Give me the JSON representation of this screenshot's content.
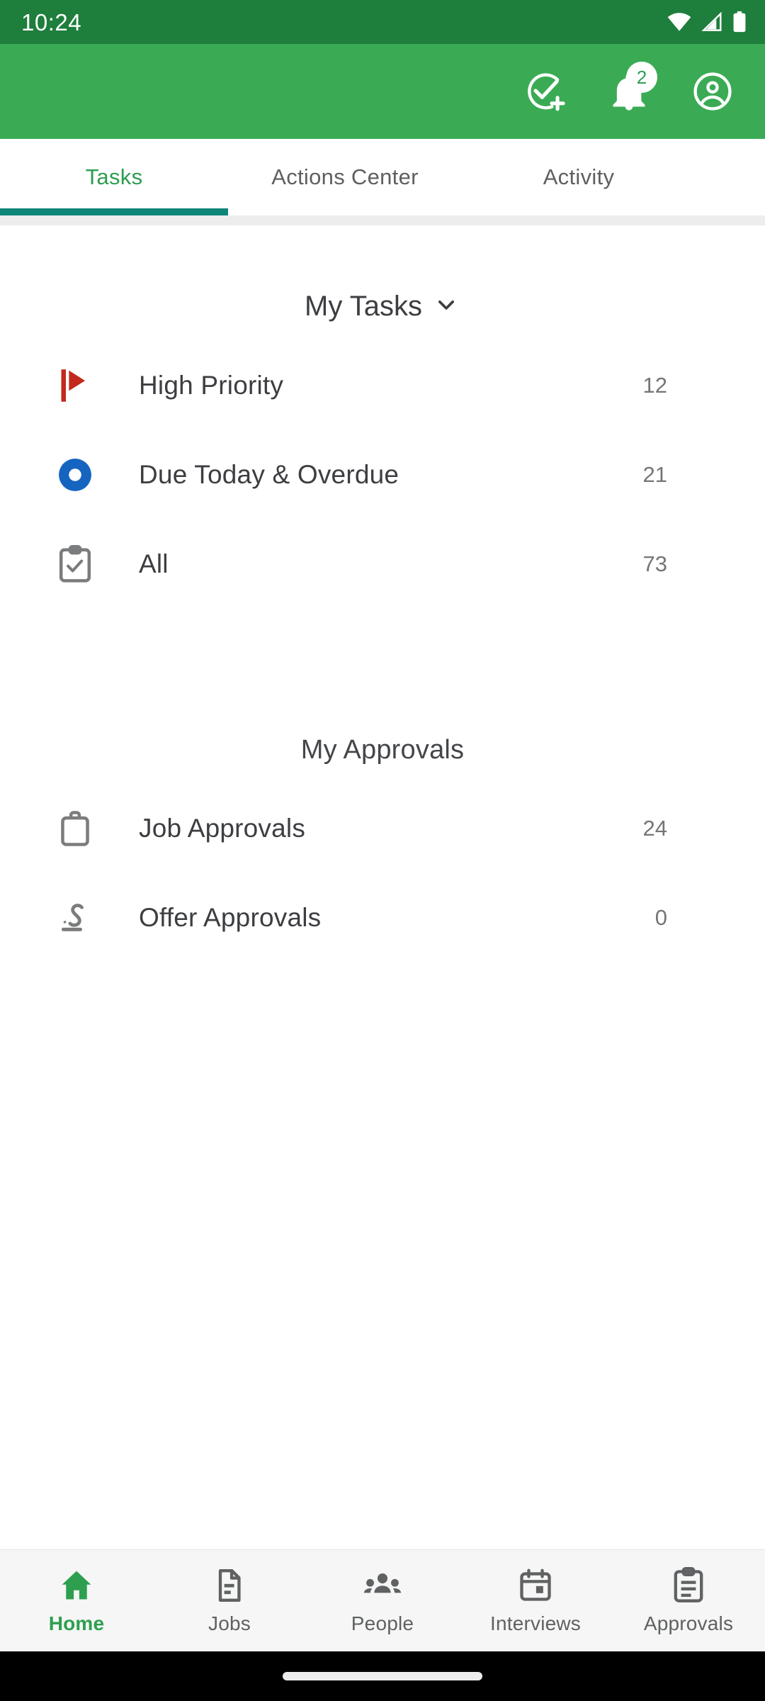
{
  "status_bar": {
    "clock": "10:24",
    "icons": [
      "wifi-icon",
      "cellular-signal-icon",
      "battery-icon"
    ]
  },
  "app_bar": {
    "background_color": "#3AAB54",
    "actions": [
      {
        "name": "add-task-icon",
        "label": "Add Task"
      },
      {
        "name": "notifications-icon",
        "label": "Notifications",
        "badge": "2"
      },
      {
        "name": "account-icon",
        "label": "Account"
      }
    ]
  },
  "tabs": {
    "active_index": 0,
    "active_color": "#2E9E4F",
    "indicator_color": "#0E8579",
    "items": [
      {
        "label": "Tasks"
      },
      {
        "label": "Actions Center"
      },
      {
        "label": "Activity"
      }
    ]
  },
  "my_tasks": {
    "title": "My Tasks",
    "dropdown_icon": "chevron-down-icon",
    "rows": [
      {
        "label": "High Priority",
        "count": "12",
        "icon": "flag-icon",
        "icon_color": "#C3291C"
      },
      {
        "label": "Due Today & Overdue",
        "count": "21",
        "icon": "donut-circle-icon",
        "icon_color": "#1565C0"
      },
      {
        "label": "All",
        "count": "73",
        "icon": "clipboard-check-icon",
        "icon_color": "#7A7C7E"
      }
    ]
  },
  "my_approvals": {
    "title": "My Approvals",
    "rows": [
      {
        "label": "Job Approvals",
        "count": "24",
        "icon": "briefcase-icon",
        "icon_color": "#7A7C7E"
      },
      {
        "label": "Offer Approvals",
        "count": "0",
        "icon": "signature-icon",
        "icon_color": "#7A7C7E"
      }
    ]
  },
  "bottom_nav": {
    "active_index": 0,
    "active_color": "#2E9E4F",
    "items": [
      {
        "label": "Home",
        "icon": "home-icon"
      },
      {
        "label": "Jobs",
        "icon": "document-icon"
      },
      {
        "label": "People",
        "icon": "people-icon"
      },
      {
        "label": "Interviews",
        "icon": "calendar-icon"
      },
      {
        "label": "Approvals",
        "icon": "clipboard-icon"
      }
    ]
  }
}
